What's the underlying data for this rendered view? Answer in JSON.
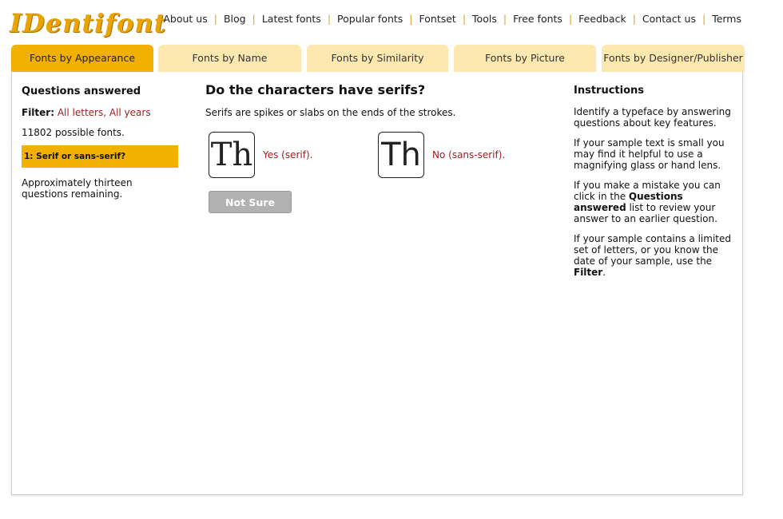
{
  "logo": {
    "text": "IDentifont"
  },
  "nav": [
    "About us",
    "Blog",
    "Latest fonts",
    "Popular fonts",
    "Fontset",
    "Tools",
    "Free fonts",
    "Feedback",
    "Contact us",
    "Terms"
  ],
  "tabs": [
    "Fonts by Appearance",
    "Fonts by Name",
    "Fonts by Similarity",
    "Fonts by Picture",
    "Fonts by Designer/Publisher"
  ],
  "left": {
    "heading": "Questions answered",
    "filter_label": "Filter:",
    "filter_value": "All letters, All years",
    "count": "11802 possible fonts.",
    "answered_item": "1: Serif or sans-serif?",
    "remaining": "Approximately thirteen questions remaining."
  },
  "question": {
    "title": "Do the characters have serifs?",
    "description": "Serifs are spikes or slabs on the ends of the strokes.",
    "yes_sample": "Th",
    "yes_label": "Yes (serif).",
    "no_sample": "Th",
    "no_label": "No (sans-serif).",
    "not_sure": "Not Sure"
  },
  "instructions": {
    "heading": "Instructions",
    "p1": "Identify a typeface by answering questions about key features.",
    "p2": "If your sample text is small you may find it helpful to use a magnifying glass or hand lens.",
    "p3_a": "If you make a mistake you can click in the ",
    "p3_b": "Questions answered",
    "p3_c": " list to review your answer to an earlier question.",
    "p4_a": "If your sample contains a limited set of letters, or you know the date of your sample, use the ",
    "p4_b": "Filter",
    "p4_c": "."
  },
  "colors": {
    "accent": "#f2b100",
    "tab_inactive": "#fde8b0",
    "link_red": "#a01c1c"
  }
}
